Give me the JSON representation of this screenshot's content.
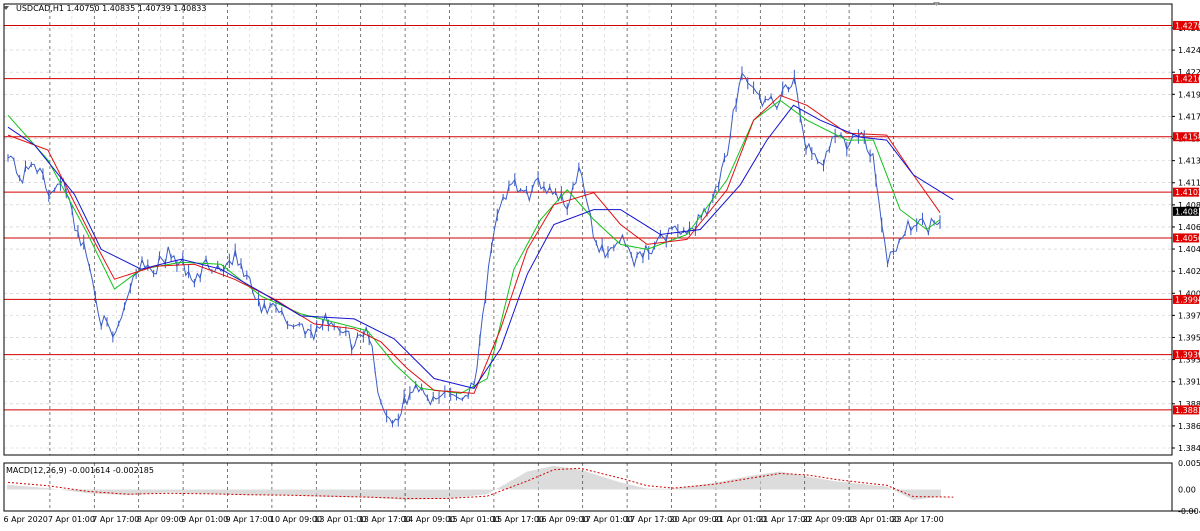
{
  "header": {
    "symbol_info": "USDCAD,H1  1.40750 1.40835 1.40739 1.40833"
  },
  "macd_label": "MACD(12,26,9) -0.001614 -0.002185",
  "colors": {
    "background": "#ffffff",
    "grid": "#c8c8c8",
    "vgrid": "#404040",
    "frame": "#000000",
    "price_line": "#3a5bc7",
    "ma_fast": "#12c21a",
    "ma_mid": "#e01010",
    "ma_slow": "#1414d0",
    "level_line": "#d20000",
    "level_tag_bg": "#e00000",
    "level_tag_text": "#ffffff",
    "current_tag_bg": "#000000",
    "macd_hist": "#a8a8a8",
    "macd_signal": "#d20000"
  },
  "chart_data": {
    "type": "line",
    "ylim": [
      1.3838,
      1.4292
    ],
    "y_ticks": [
      "1.42650",
      "1.42430",
      "1.42200",
      "1.41985",
      "1.41765",
      "1.41545",
      "1.41325",
      "1.41105",
      "1.40885",
      "1.40665",
      "1.40440",
      "1.40220",
      "1.40000",
      "1.39780",
      "1.39560",
      "1.39340",
      "1.39120",
      "1.38895",
      "1.38675",
      "1.38455"
    ],
    "x_ticks": [
      "6 Apr 2020",
      "7 Apr 01:00",
      "7 Apr 17:00",
      "8 Apr 09:00",
      "9 Apr 01:00",
      "9 Apr 17:00",
      "10 Apr 09:00",
      "13 Apr 01:00",
      "13 Apr 17:00",
      "14 Apr 09:00",
      "15 Apr 01:00",
      "15 Apr 17:00",
      "16 Apr 09:00",
      "17 Apr 01:00",
      "17 Apr 17:00",
      "20 Apr 09:00",
      "21 Apr 01:00",
      "21 Apr 17:00",
      "22 Apr 09:00",
      "23 Apr 01:00",
      "23 Apr 17:00"
    ],
    "levels": [
      "1.42704",
      "1.42169",
      "1.41584",
      "1.41026",
      "1.40565",
      "1.39946",
      "1.39391",
      "1.38834"
    ],
    "current_price": "1.40833",
    "price_anchors": [
      1.4145,
      1.4115,
      1.4135,
      1.4102,
      1.4118,
      1.4072,
      1.4035,
      1.3975,
      1.3953,
      1.4002,
      1.4035,
      1.4025,
      1.404,
      1.403,
      1.4012,
      1.4033,
      1.4025,
      1.4038,
      1.4015,
      1.3982,
      1.3985,
      1.3972,
      1.3968,
      1.3962,
      1.3975,
      1.3966,
      1.3948,
      1.397,
      1.389,
      1.387,
      1.3895,
      1.391,
      1.3888,
      1.3905,
      1.3895,
      1.391,
      1.4015,
      1.4095,
      1.4108,
      1.4098,
      1.4112,
      1.4105,
      1.409,
      1.4125,
      1.4055,
      1.404,
      1.4058,
      1.4035,
      1.4045,
      1.4053,
      1.407,
      1.4055,
      1.408,
      1.4095,
      1.4138,
      1.4225,
      1.4205,
      1.419,
      1.4195,
      1.4215,
      1.4148,
      1.4125,
      1.4165,
      1.415,
      1.416,
      1.4138,
      1.4035,
      1.4055,
      1.4075,
      1.4068,
      1.4078
    ],
    "ma_fast_anchors": [
      [
        0,
        1.418
      ],
      [
        3,
        1.4135
      ],
      [
        6,
        1.406
      ],
      [
        8,
        1.4005
      ],
      [
        10,
        1.4025
      ],
      [
        13,
        1.4032
      ],
      [
        16,
        1.403
      ],
      [
        19,
        1.3998
      ],
      [
        22,
        1.398
      ],
      [
        25,
        1.397
      ],
      [
        27,
        1.3963
      ],
      [
        29,
        1.393
      ],
      [
        31,
        1.3905
      ],
      [
        34,
        1.39
      ],
      [
        36,
        1.3915
      ],
      [
        38,
        1.4025
      ],
      [
        40,
        1.4075
      ],
      [
        42,
        1.4105
      ],
      [
        44,
        1.4075
      ],
      [
        46,
        1.405
      ],
      [
        48,
        1.4045
      ],
      [
        51,
        1.406
      ],
      [
        54,
        1.4115
      ],
      [
        56,
        1.4175
      ],
      [
        58,
        1.4195
      ],
      [
        60,
        1.4175
      ],
      [
        63,
        1.4155
      ],
      [
        65,
        1.4155
      ],
      [
        67,
        1.4085
      ],
      [
        69,
        1.4065
      ],
      [
        70,
        1.4075
      ]
    ],
    "ma_mid_anchors": [
      [
        0,
        1.416
      ],
      [
        3,
        1.4145
      ],
      [
        6,
        1.4065
      ],
      [
        8,
        1.4015
      ],
      [
        11,
        1.4028
      ],
      [
        14,
        1.403
      ],
      [
        17,
        1.4015
      ],
      [
        20,
        1.3995
      ],
      [
        23,
        1.397
      ],
      [
        26,
        1.3965
      ],
      [
        28,
        1.3952
      ],
      [
        30,
        1.3925
      ],
      [
        32,
        1.3903
      ],
      [
        35,
        1.39
      ],
      [
        37,
        1.3965
      ],
      [
        39,
        1.4045
      ],
      [
        41,
        1.409
      ],
      [
        44,
        1.4102
      ],
      [
        46,
        1.407
      ],
      [
        48,
        1.405
      ],
      [
        51,
        1.4055
      ],
      [
        54,
        1.4105
      ],
      [
        56,
        1.4175
      ],
      [
        58,
        1.42
      ],
      [
        60,
        1.419
      ],
      [
        63,
        1.4162
      ],
      [
        66,
        1.416
      ],
      [
        68,
        1.412
      ],
      [
        70,
        1.4082
      ]
    ],
    "ma_slow_anchors": [
      [
        0,
        1.4168
      ],
      [
        2,
        1.415
      ],
      [
        5,
        1.41
      ],
      [
        7,
        1.4045
      ],
      [
        10,
        1.4025
      ],
      [
        13,
        1.4035
      ],
      [
        16,
        1.4025
      ],
      [
        19,
        1.4002
      ],
      [
        22,
        1.3978
      ],
      [
        26,
        1.3975
      ],
      [
        29,
        1.3955
      ],
      [
        32,
        1.3915
      ],
      [
        35,
        1.3905
      ],
      [
        37,
        1.3945
      ],
      [
        39,
        1.402
      ],
      [
        41,
        1.407
      ],
      [
        44,
        1.4085
      ],
      [
        46,
        1.4085
      ],
      [
        49,
        1.406
      ],
      [
        52,
        1.4065
      ],
      [
        55,
        1.411
      ],
      [
        57,
        1.4155
      ],
      [
        59,
        1.419
      ],
      [
        61,
        1.4175
      ],
      [
        64,
        1.4158
      ],
      [
        66,
        1.4155
      ],
      [
        68,
        1.412
      ],
      [
        71,
        1.4095
      ]
    ],
    "macd_ticks": [
      "0.005615",
      "0.00",
      "-0.00455"
    ],
    "macd_hist_anchors": [
      [
        0,
        0.001
      ],
      [
        3,
        0.0003
      ],
      [
        6,
        -0.0008
      ],
      [
        9,
        -0.0012
      ],
      [
        12,
        -0.0006
      ],
      [
        15,
        -0.0009
      ],
      [
        18,
        -0.0012
      ],
      [
        21,
        -0.0012
      ],
      [
        24,
        -0.0016
      ],
      [
        27,
        -0.0017
      ],
      [
        30,
        -0.0022
      ],
      [
        33,
        -0.0019
      ],
      [
        36,
        -0.001
      ],
      [
        39,
        0.0038
      ],
      [
        41,
        0.005
      ],
      [
        43,
        0.0042
      ],
      [
        46,
        0.0015
      ],
      [
        48,
        0.0002
      ],
      [
        50,
        0.0002
      ],
      [
        53,
        0.0014
      ],
      [
        56,
        0.003
      ],
      [
        58,
        0.0038
      ],
      [
        60,
        0.0028
      ],
      [
        62,
        0.0018
      ],
      [
        64,
        0.0012
      ],
      [
        66,
        0.0006
      ],
      [
        68,
        -0.0022
      ],
      [
        71,
        -0.0012
      ]
    ],
    "macd_signal_anchors": [
      [
        0,
        0.0015
      ],
      [
        3,
        0.0008
      ],
      [
        6,
        -0.0004
      ],
      [
        9,
        -0.001
      ],
      [
        12,
        -0.0008
      ],
      [
        15,
        -0.0009
      ],
      [
        18,
        -0.0011
      ],
      [
        21,
        -0.0012
      ],
      [
        24,
        -0.0014
      ],
      [
        27,
        -0.0016
      ],
      [
        30,
        -0.0019
      ],
      [
        33,
        -0.0019
      ],
      [
        36,
        -0.0014
      ],
      [
        39,
        0.0018
      ],
      [
        41,
        0.0042
      ],
      [
        43,
        0.0045
      ],
      [
        46,
        0.0024
      ],
      [
        48,
        0.0008
      ],
      [
        50,
        0.0003
      ],
      [
        53,
        0.0011
      ],
      [
        56,
        0.0025
      ],
      [
        58,
        0.0034
      ],
      [
        60,
        0.0031
      ],
      [
        62,
        0.0022
      ],
      [
        64,
        0.0015
      ],
      [
        66,
        0.0009
      ],
      [
        68,
        -0.0015
      ],
      [
        71,
        -0.0016
      ]
    ]
  }
}
